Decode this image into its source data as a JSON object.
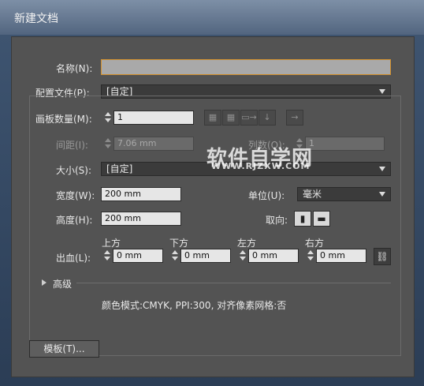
{
  "window": {
    "title": "新建文档"
  },
  "name": {
    "label": "名称(N):",
    "value": ""
  },
  "profile": {
    "label": "配置文件(P):",
    "value": "[自定]"
  },
  "artboards": {
    "label": "画板数量(M):",
    "value": "1",
    "spacing_label": "间距(I):",
    "spacing_value": "7.06 mm",
    "columns_label": "列数(O):",
    "columns_value": "1",
    "arrange_icons": [
      "grid-by-row-icon",
      "grid-by-column-icon",
      "arrange-by-row-icon",
      "arrange-by-column-icon"
    ],
    "rtl_icon": "right-to-left-icon"
  },
  "size": {
    "label": "大小(S):",
    "value": "[自定]"
  },
  "width": {
    "label": "宽度(W):",
    "value": "200 mm"
  },
  "height": {
    "label": "高度(H):",
    "value": "200 mm"
  },
  "units": {
    "label": "单位(U):",
    "value": "毫米"
  },
  "orientation": {
    "label": "取向:",
    "icons": [
      "portrait-icon",
      "landscape-icon"
    ]
  },
  "bleed": {
    "label": "出血(L):",
    "top_label": "上方",
    "top_value": "0 mm",
    "bottom_label": "下方",
    "bottom_value": "0 mm",
    "left_label": "左方",
    "left_value": "0 mm",
    "right_label": "右方",
    "right_value": "0 mm",
    "link_icon": "chain-link-icon"
  },
  "advanced": {
    "label": "高级",
    "summary": "颜色模式:CMYK, PPI:300, 对齐像素网格:否"
  },
  "templates_button": "模板(T)...",
  "watermark": {
    "main": "软件自学网",
    "sub": "WWW.RJZXW.COM"
  },
  "colors": {
    "focus_border": "#d2902c",
    "panel_bg": "#535353",
    "title_bar": "#52657f"
  }
}
